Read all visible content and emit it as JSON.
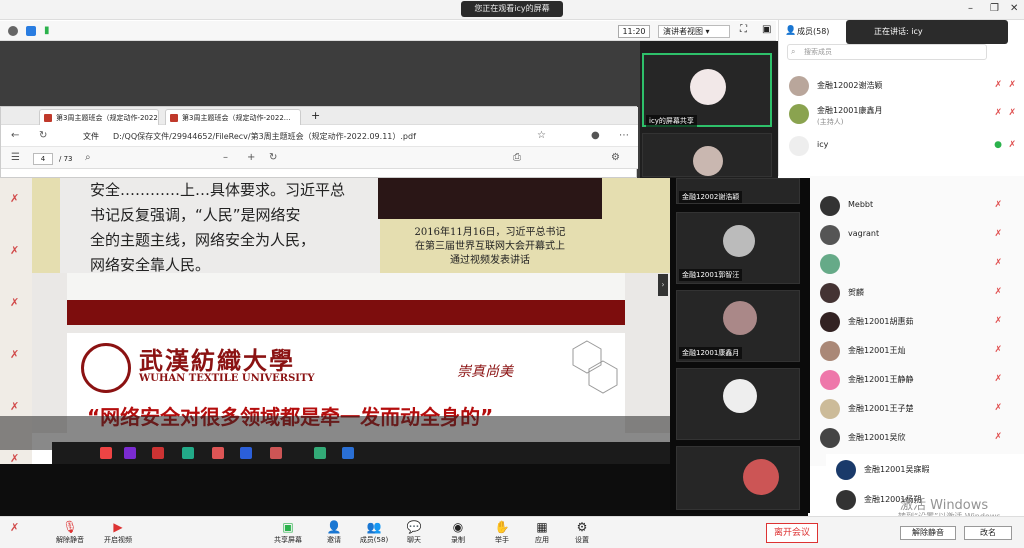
{
  "share_banner": "您正在观看icy的屏幕",
  "infobar": {
    "time": "11:20",
    "view_label": "演讲者视图"
  },
  "browser": {
    "tabs": [
      "第3周主题班会（规定动作-2022...",
      "第3周主题班会（规定动作-2022..."
    ],
    "file_label": "文件",
    "url": "D:/QQ保存文件/29944652/FileRecv/第3周主题班会（规定动作-2022.09.11）.pdf",
    "page": "4",
    "page_total": "/ 73"
  },
  "slide": {
    "text_lines": [
      "安全…………上…具体要求。习近平总",
      "书记反复强调，“人民”是网络安",
      "全的主题主线，网络安全为人民，",
      "网络安全靠人民。"
    ],
    "caption": [
      "2016年11月16日，习近平总书记",
      "在第三届世界互联网大会开幕式上",
      "通过视频发表讲话"
    ],
    "univ_cn": "武漢紡織大學",
    "univ_en": "WUHAN TEXTILE UNIVERSITY",
    "motto": "崇真尚美",
    "quote": "“网络安全对很多领域都是牵一发而动全身的”"
  },
  "video": {
    "tile1_label": "icy的屏幕共享",
    "gallery": [
      "金融12002谢浩颖",
      "金融12001郭智汪",
      "金融12001康鑫月",
      "",
      ""
    ]
  },
  "panel": {
    "title": "成员(58)",
    "search_placeholder": "搜索成员",
    "speaking": "正在讲话: icy",
    "members": [
      {
        "name": "金融12002谢浩颖",
        "sub": ""
      },
      {
        "name": "金融12001康鑫月",
        "sub": "(主持人)"
      },
      {
        "name": "icy",
        "sub": ""
      }
    ],
    "members_lower": [
      "Mebbt",
      "vagrant",
      "",
      "贺麟",
      "金融12001胡惠茹",
      "金融12001王灿",
      "金融12001王静静",
      "金融12001王子楚",
      "金融12001吴欣"
    ],
    "members_bottom": [
      "金融12001吴寐暇",
      "金融12001杨朔"
    ],
    "mute_all": "解除静音",
    "rename": "改名"
  },
  "toolbar": {
    "items": [
      "解除静音",
      "开启视频",
      "共享屏幕",
      "邀请",
      "成员(58)",
      "聊天",
      "录制",
      "举手",
      "应用",
      "设置"
    ],
    "leave": "离开会议"
  },
  "watermark": {
    "line1": "激活 Windows",
    "line2": "转到“设置”以激活 Windows。"
  }
}
